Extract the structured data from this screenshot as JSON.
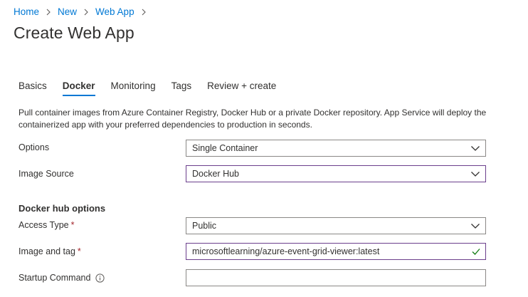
{
  "breadcrumb": {
    "items": [
      "Home",
      "New",
      "Web App"
    ]
  },
  "page": {
    "title": "Create Web App"
  },
  "tabs": [
    {
      "label": "Basics"
    },
    {
      "label": "Docker"
    },
    {
      "label": "Monitoring"
    },
    {
      "label": "Tags"
    },
    {
      "label": "Review + create"
    }
  ],
  "active_tab": "Docker",
  "description": "Pull container images from Azure Container Registry, Docker Hub or a private Docker repository. App Service will deploy the containerized app with your preferred dependencies to production in seconds.",
  "form": {
    "options": {
      "label": "Options",
      "value": "Single Container"
    },
    "image_source": {
      "label": "Image Source",
      "value": "Docker Hub"
    },
    "section_heading": "Docker hub options",
    "access_type": {
      "label": "Access Type",
      "required_mark": "*",
      "value": "Public"
    },
    "image_and_tag": {
      "label": "Image and tag",
      "required_mark": "*",
      "value": "microsoftlearning/azure-event-grid-viewer:latest"
    },
    "startup_command": {
      "label": "Startup Command",
      "value": ""
    }
  },
  "colors": {
    "link": "#0078d4",
    "active_tab_underline": "#0078d4",
    "required": "#a4262c",
    "focused_border": "#6b3f8c",
    "valid_check": "#107c10"
  },
  "icons": [
    "chevron-right-icon",
    "chevron-down-icon",
    "checkmark-icon",
    "info-icon"
  ]
}
